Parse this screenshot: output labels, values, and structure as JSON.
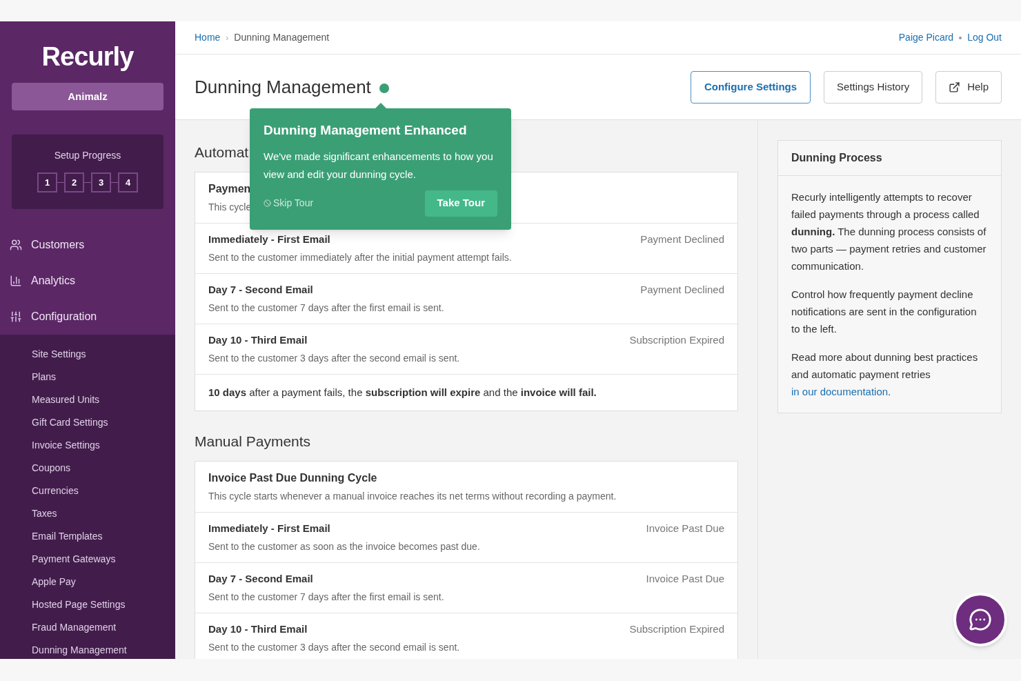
{
  "sidebar": {
    "logo": "Recurly",
    "account": "Animalz",
    "setup_progress": {
      "title": "Setup Progress",
      "steps": [
        "1",
        "2",
        "3",
        "4"
      ]
    },
    "nav": [
      {
        "label": "Customers",
        "kind": "users"
      },
      {
        "label": "Analytics",
        "kind": "chart"
      },
      {
        "label": "Configuration",
        "kind": "sliders"
      }
    ],
    "subnav": [
      "Site Settings",
      "Plans",
      "Measured Units",
      "Gift Card Settings",
      "Invoice Settings",
      "Coupons",
      "Currencies",
      "Taxes",
      "Email Templates",
      "Payment Gateways",
      "Apple Pay",
      "Hosted Page Settings",
      "Fraud Management",
      "Dunning Management"
    ]
  },
  "breadcrumb": [
    "Home",
    "›",
    "Dunning Management"
  ],
  "user": {
    "name": "Paige Picard",
    "logout": "Log Out"
  },
  "page_title": "Dunning Management",
  "actions": [
    "Configure Settings",
    "Settings History",
    "Help"
  ],
  "tour": {
    "title": "Dunning Management Enhanced",
    "body": "We've made significant enhancements to how you view and edit your dunning cycle.",
    "skip": "Skip Tour",
    "take": "Take Tour"
  },
  "sections": [
    {
      "heading": "Automat",
      "cycle": {
        "title": "Paymen",
        "desc": "This cycle"
      },
      "rows": [
        {
          "title": "Immediately - First Email",
          "desc": "Sent to the customer immediately after the initial payment attempt fails.",
          "trigger": "Payment Declined"
        },
        {
          "title": "Day 7 - Second Email",
          "desc": "Sent to the customer 7 days after the first email is sent.",
          "trigger": "Payment Declined"
        },
        {
          "title": "Day 10 - Third Email",
          "desc": "Sent to the customer 3 days after the second email is sent.",
          "trigger": "Subscription Expired"
        }
      ],
      "summary": "**10 days** after a payment fails, the **subscription will expire** and the **invoice will fail.**"
    },
    {
      "heading": "Manual Payments",
      "cycle": {
        "title": "Invoice Past Due Dunning Cycle",
        "desc": "This cycle starts whenever a manual invoice reaches its net terms without recording a payment."
      },
      "rows": [
        {
          "title": "Immediately - First Email",
          "desc": "Sent to the customer as soon as the invoice becomes past due.",
          "trigger": "Invoice Past Due"
        },
        {
          "title": "Day 7 - Second Email",
          "desc": "Sent to the customer 7 days after the first email is sent.",
          "trigger": "Invoice Past Due"
        },
        {
          "title": "Day 10 - Third Email",
          "desc": "Sent to the customer 3 days after the second email is sent.",
          "trigger": "Subscription Expired"
        }
      ]
    }
  ],
  "panel": {
    "title": "Dunning Process",
    "paragraphs": [
      "Recurly intelligently attempts to recover failed payments through a process called **dunning.** The dunning process consists of two parts — payment retries and customer communication.",
      "Control how frequently payment decline notifications are sent in the configuration to the left."
    ],
    "more": "Read more about dunning best practices and automatic payment retries",
    "link": "in our documentation",
    "end": "."
  }
}
